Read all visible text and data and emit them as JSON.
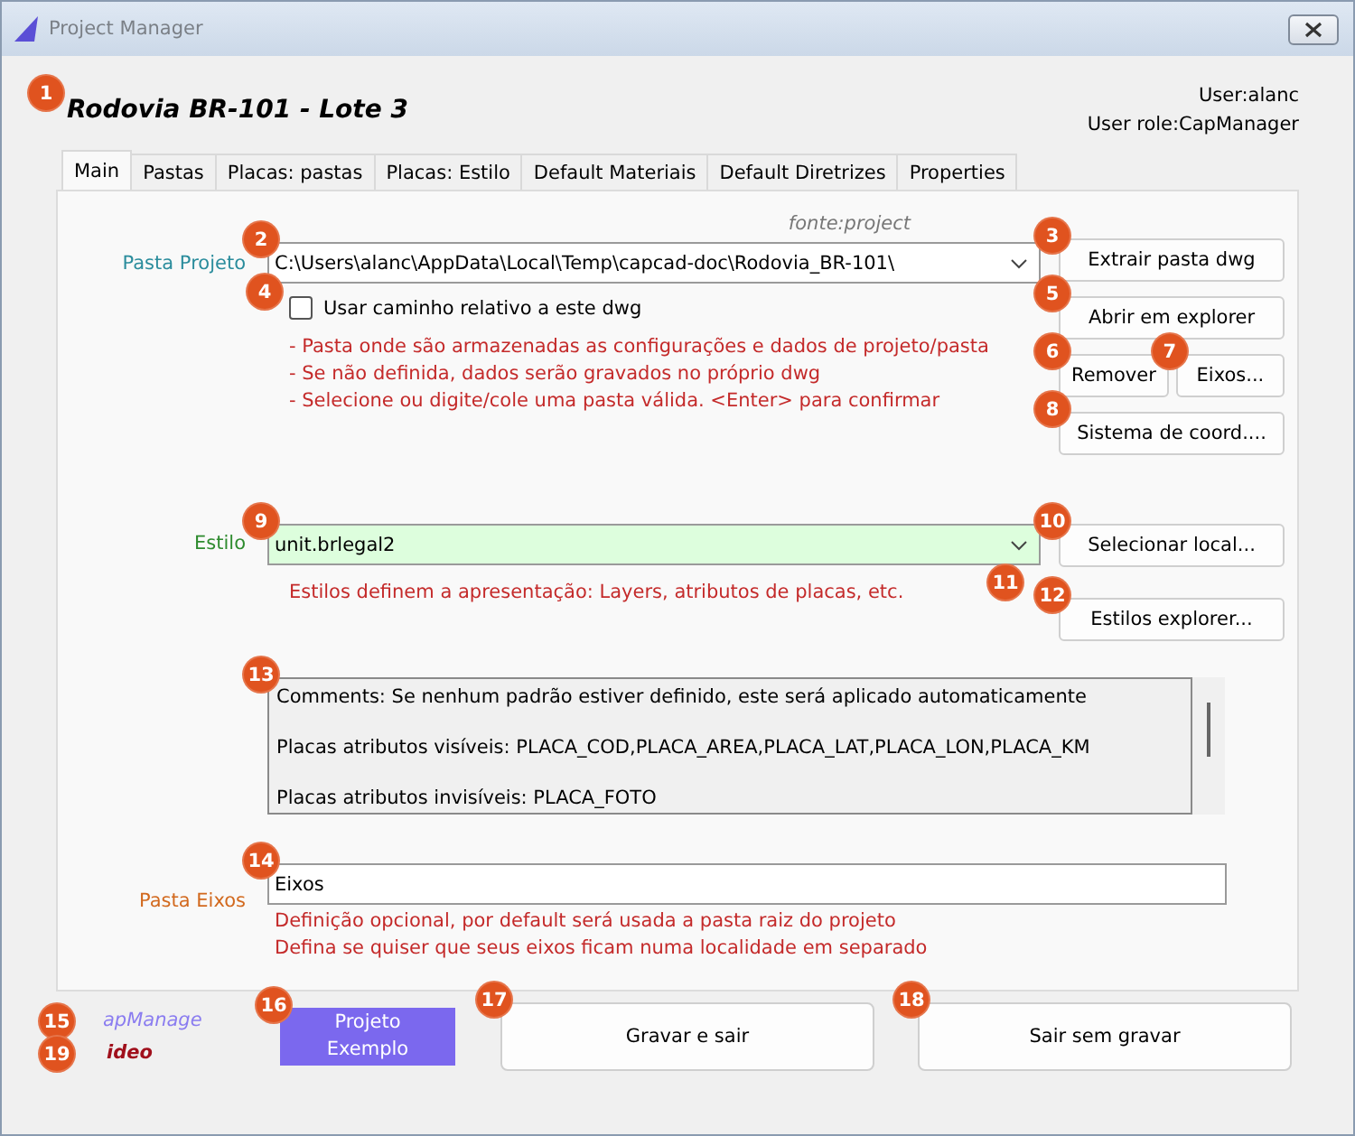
{
  "window": {
    "title": "Project Manager"
  },
  "header": {
    "project": "Rodovia BR-101 - Lote 3",
    "badge": "1",
    "user": "User:alanc",
    "role": "User role:CapManager"
  },
  "tabs": [
    {
      "label": "Main",
      "selected": true
    },
    {
      "label": "Pastas",
      "selected": false
    },
    {
      "label": "Placas: pastas",
      "selected": false
    },
    {
      "label": "Placas: Estilo",
      "selected": false
    },
    {
      "label": "Default Materiais",
      "selected": false
    },
    {
      "label": "Default Diretrizes",
      "selected": false
    },
    {
      "label": "Properties",
      "selected": false
    }
  ],
  "pasta_projeto": {
    "label": "Pasta Projeto",
    "source": "fonte:project",
    "path": "C:\\Users\\alanc\\AppData\\Local\\Temp\\capcad-doc\\Rodovia_BR-101\\",
    "badge": "2",
    "checkbox": {
      "label": "Usar caminho relativo a este dwg",
      "checked": false,
      "badge": "4"
    },
    "notes": [
      "- Pasta onde são armazenadas as configurações e dados de projeto/pasta",
      "- Se não definida, dados serão gravados no próprio dwg",
      "- Selecione ou digite/cole uma pasta válida. <Enter> para confirmar"
    ],
    "buttons": [
      {
        "label": "Extrair pasta dwg",
        "badge": "3",
        "kind": "wide"
      },
      {
        "label": "Abrir em explorer",
        "badge": "5",
        "kind": "wide"
      },
      {
        "label": "Remover",
        "badge": "6",
        "kind": "half"
      },
      {
        "label": "Eixos...",
        "badge": "7",
        "kind": "half"
      },
      {
        "label": "Sistema de coord....",
        "badge": "8",
        "kind": "wide"
      }
    ]
  },
  "estilo": {
    "label": "Estilo",
    "value": "unit.brlegal2",
    "badge": "9",
    "dropdown_badge": "11",
    "note": "Estilos definem a apresentação: Layers, atributos de placas, etc.",
    "buttons": [
      {
        "label": "Selecionar local...",
        "badge": "10"
      },
      {
        "label": "Estilos explorer...",
        "badge": "12"
      }
    ]
  },
  "comments": {
    "badge": "13",
    "lines": [
      "Comments: Se nenhum padrão estiver definido, este será aplicado automaticamente",
      "Placas atributos visíveis: PLACA_COD,PLACA_AREA,PLACA_LAT,PLACA_LON,PLACA_KM",
      "Placas atributos invisíveis: PLACA_FOTO"
    ]
  },
  "pasta_eixos": {
    "label": "Pasta Eixos",
    "value": "Eixos",
    "badge": "14",
    "notes": [
      "Definição opcional, por default será usada a pasta raiz do projeto",
      "Defina se quiser que seus eixos ficam numa localidade em separado"
    ]
  },
  "footer": {
    "links": [
      {
        "text": "apManage",
        "kind": "app",
        "badge": "15"
      },
      {
        "text": "ideo",
        "kind": "video",
        "badge": "19"
      }
    ],
    "buttons": [
      {
        "label": "Projeto Exemplo",
        "kind": "primary",
        "badge": "16"
      },
      {
        "label": "Gravar e sair",
        "kind": "normal",
        "badge": "17"
      },
      {
        "label": "Sair sem gravar",
        "kind": "normal",
        "badge": "18"
      }
    ]
  }
}
